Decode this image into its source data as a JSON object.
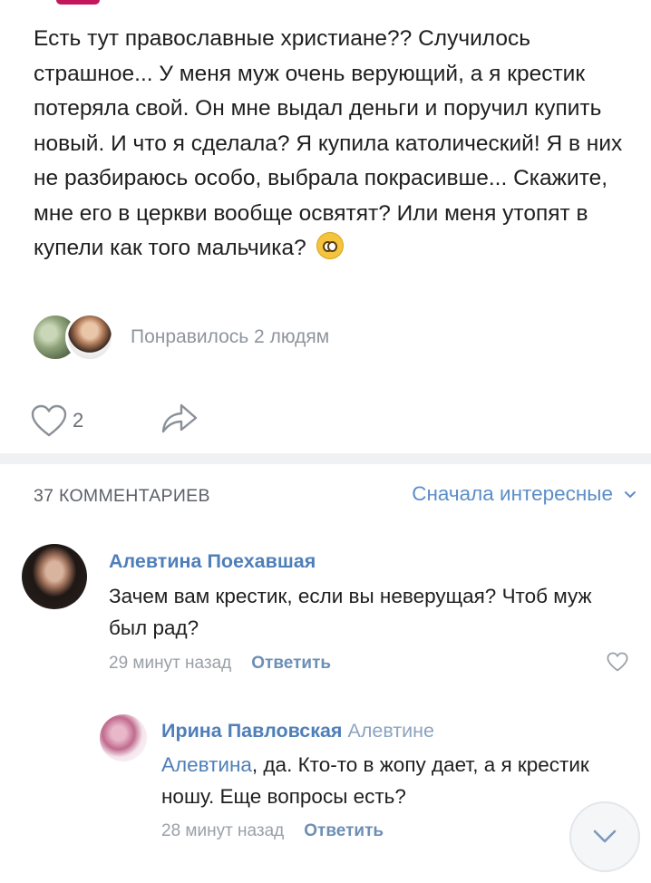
{
  "post": {
    "text": "Есть тут православные христиане?? Случилось страшное... У меня муж очень верующий, а я крестик потеряла свой. Он мне выдал деньги и поручил купить новый. И что я сделала? Я купила католический! Я в них не разбираюсь особо, выбрала покрасивше... Скажите, мне его в церкви вообще освятят? Или меня утопят в купели как того мальчика?",
    "emoji_icon": "flushed-face-emoji",
    "likes_text": "Понравилось 2 людям",
    "like_count": "2"
  },
  "comments_header": {
    "count_label": "37 КОММЕНТАРИЕВ",
    "sort_label": "Сначала интересные"
  },
  "comments": [
    {
      "author": "Алевтина Поехавшая",
      "text": "Зачем вам крестик, если вы неверущая? Чтоб муж был рад?",
      "time": "29 минут назад",
      "reply_label": "Ответить"
    },
    {
      "author": "Ирина Павловская",
      "reply_to": "Алевтине",
      "mention": "Алевтина",
      "text": ", да. Кто-то в жопу дает, а я крестик ношу. Еще вопросы есть?",
      "time": "28 минут назад",
      "reply_label": "Ответить"
    }
  ],
  "colors": {
    "link": "#4f7fb8",
    "muted": "#9aa0a6",
    "accent": "#c2185b"
  }
}
